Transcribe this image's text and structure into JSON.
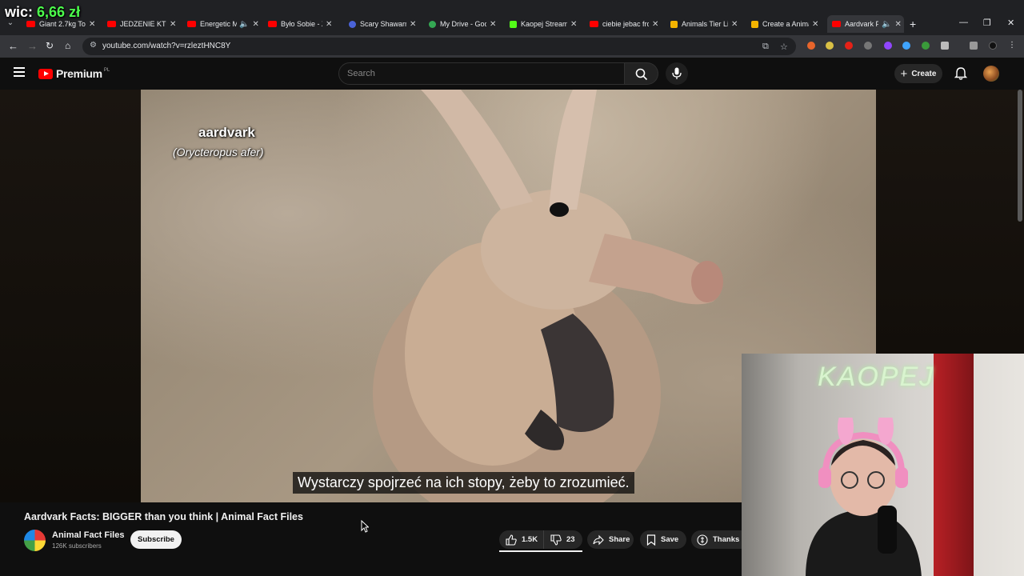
{
  "overlay": {
    "prefix": "wic:",
    "amount": "6,66 zł"
  },
  "browser": {
    "tabs": [
      {
        "title": "Giant 2.7kg To",
        "favicon_color": "#ff0000"
      },
      {
        "title": "JEDZENIE KTÓ",
        "favicon_color": "#ff0000"
      },
      {
        "title": "Energetic M",
        "favicon_color": "#ff0000"
      },
      {
        "title": "Było Sobie - Zy",
        "favicon_color": "#ff0000"
      },
      {
        "title": "Scary Shawarm",
        "favicon_color": "#4a63d8"
      },
      {
        "title": "My Drive - Goo",
        "favicon_color": "#34a853"
      },
      {
        "title": "Kaopej Stream",
        "favicon_color": "#53fc18"
      },
      {
        "title": "ciebie jebac fro",
        "favicon_color": "#ff0000"
      },
      {
        "title": "Animals Tier Lis",
        "favicon_color": "#f4b400"
      },
      {
        "title": "Create a Anima",
        "favicon_color": "#f4b400"
      },
      {
        "title": "Aardvark F",
        "favicon_color": "#ff0000",
        "active": true
      }
    ],
    "url": "youtube.com/watch?v=rzleztHNC8Y"
  },
  "youtube": {
    "brand": "Premium",
    "country_code": "PL",
    "search_placeholder": "Search",
    "create_label": "Create"
  },
  "video": {
    "overlay_name": "aardvark",
    "overlay_latin": "(Orycteropus afer)",
    "subtitle": "Wystarczy spojrzeć na ich stopy, żeby to zrozumieć.",
    "webcam_sign": "KAOPEJ"
  },
  "info": {
    "title": "Aardvark Facts: BIGGER than you think | Animal Fact Files",
    "channel_name": "Animal Fact Files",
    "subscribers": "126K subscribers",
    "subscribe_label": "Subscribe",
    "likes": "1.5K",
    "dislikes": "23",
    "share_label": "Share",
    "save_label": "Save",
    "thanks_label": "Thanks"
  }
}
